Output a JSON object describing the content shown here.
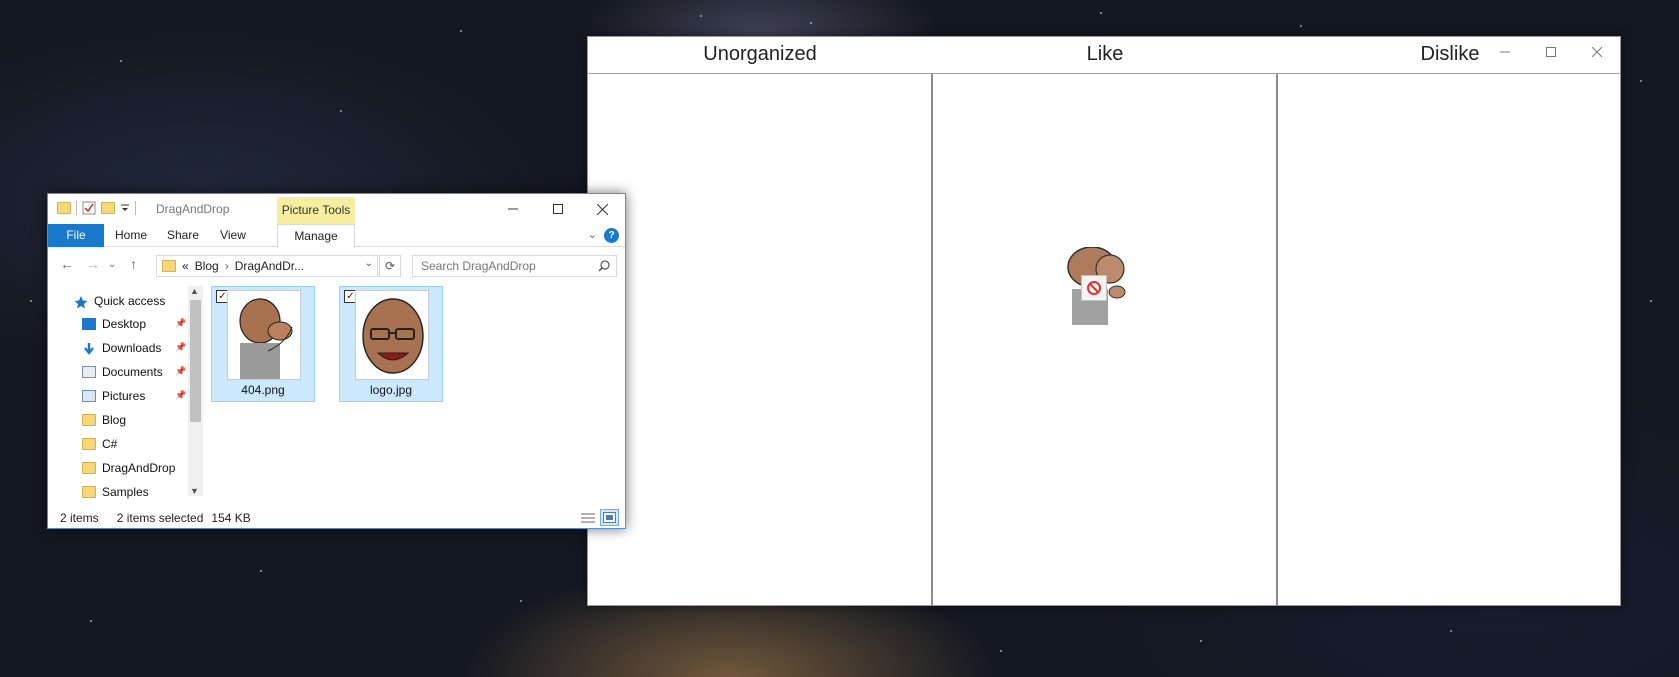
{
  "sorter_app": {
    "columns": [
      "Unorganized",
      "Like",
      "Dislike"
    ],
    "controls": {
      "minimize": "minimize-icon",
      "maximize": "maximize-icon",
      "close": "close-icon"
    },
    "drag_cursor": "no-drop-icon"
  },
  "explorer": {
    "title": "DragAndDrop",
    "context_tab": "Picture Tools",
    "ribbon_tabs": [
      "File",
      "Home",
      "Share",
      "View",
      "Manage"
    ],
    "address": {
      "overflow": "«",
      "crumbs": [
        "Blog",
        "DragAndDr..."
      ]
    },
    "search_placeholder": "Search DragAndDrop",
    "nav_items": [
      {
        "label": "Quick access",
        "icon": "star-icon",
        "pinned": false
      },
      {
        "label": "Desktop",
        "icon": "desktop-icon",
        "pinned": true
      },
      {
        "label": "Downloads",
        "icon": "download-icon",
        "pinned": true
      },
      {
        "label": "Documents",
        "icon": "documents-icon",
        "pinned": true
      },
      {
        "label": "Pictures",
        "icon": "pictures-icon",
        "pinned": true
      },
      {
        "label": "Blog",
        "icon": "folder-icon",
        "pinned": false
      },
      {
        "label": "C#",
        "icon": "folder-icon",
        "pinned": false
      },
      {
        "label": "DragAndDrop",
        "icon": "folder-icon",
        "pinned": false
      },
      {
        "label": "Samples",
        "icon": "folder-icon",
        "pinned": false
      }
    ],
    "files": [
      {
        "name": "404.png",
        "selected": true,
        "checked": true
      },
      {
        "name": "logo.jpg",
        "selected": true,
        "checked": true
      }
    ],
    "status": {
      "count": "2 items",
      "selection": "2 items selected",
      "size": "154 KB"
    },
    "colors": {
      "accent": "#1979ca",
      "selection": "#cce8ff",
      "context_tab": "#f6ee9e"
    }
  }
}
